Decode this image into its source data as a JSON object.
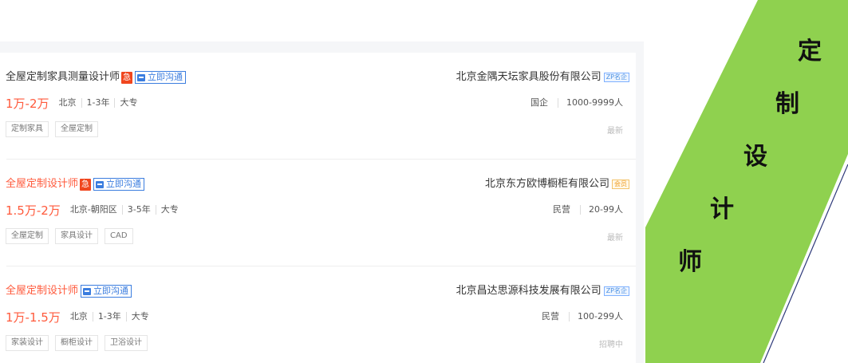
{
  "jobs": [
    {
      "title": "全屋定制家具测量设计师",
      "urgent": "急",
      "chat_label": "立即沟通",
      "salary": "1万-2万",
      "location": "北京",
      "experience": "1-3年",
      "education": "大专",
      "company": "北京金隅天坛家具股份有限公司",
      "company_badge": "ZP名企",
      "company_type": "国企",
      "company_size": "1000-9999人",
      "tags": [
        "定制家具",
        "全屋定制"
      ],
      "status": "最新"
    },
    {
      "title": "全屋定制设计师",
      "urgent": "急",
      "chat_label": "立即沟通",
      "salary": "1.5万-2万",
      "location": "北京-朝阳区",
      "experience": "3-5年",
      "education": "大专",
      "company": "北京东方欧博橱柜有限公司",
      "company_badge": "会员",
      "company_type": "民营",
      "company_size": "20-99人",
      "tags": [
        "全屋定制",
        "家具设计",
        "CAD"
      ],
      "status": "最新"
    },
    {
      "title": "全屋定制设计师",
      "urgent": "",
      "chat_label": "立即沟通",
      "salary": "1万-1.5万",
      "location": "北京",
      "experience": "1-3年",
      "education": "大专",
      "company": "北京昌达思源科技发展有限公司",
      "company_badge": "ZP名企",
      "company_type": "民营",
      "company_size": "100-299人",
      "tags": [
        "家装设计",
        "橱柜设计",
        "卫浴设计"
      ],
      "status": "招聘中"
    }
  ],
  "banner": {
    "chars": [
      "定",
      "制",
      "设",
      "计",
      "师"
    ],
    "accent_color": "#8fd14f"
  },
  "colors": {
    "salary": "#ff5a3c",
    "chat": "#3b7ddf",
    "urgent": "#f0461e"
  },
  "icons": {
    "chat": "chat-bubble-icon"
  }
}
